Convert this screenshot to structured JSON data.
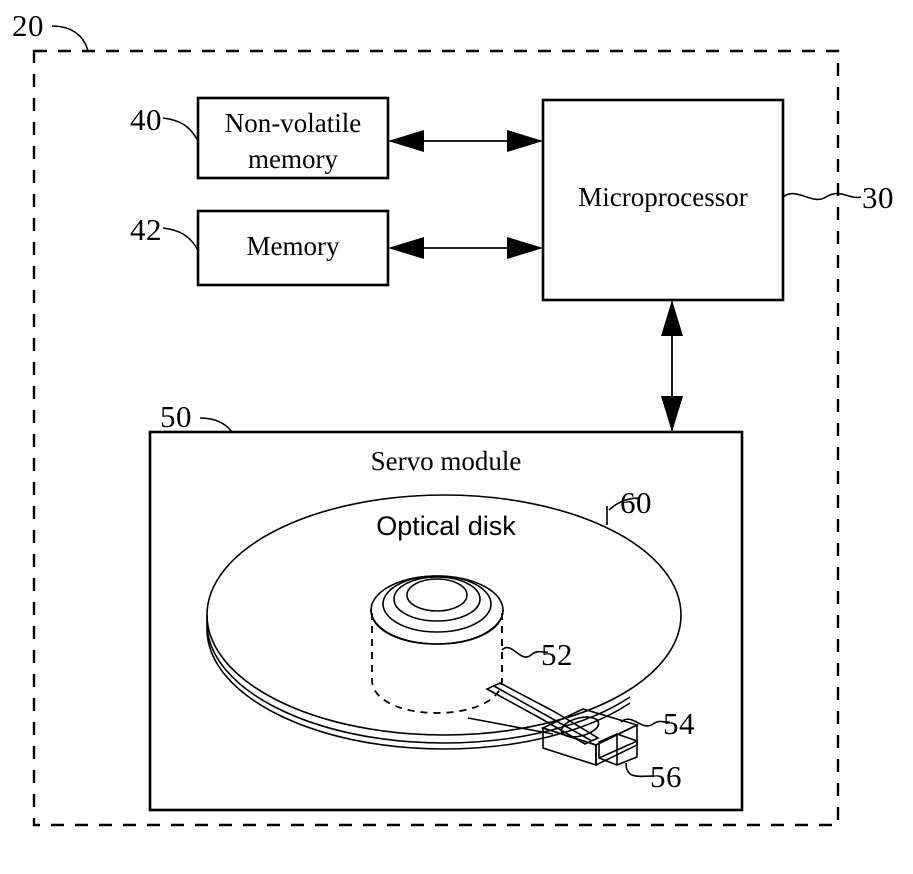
{
  "figure": {
    "title": "Optical disk drive block diagram",
    "line_color": "#000000",
    "background_color": "#ffffff"
  },
  "enclosure": {
    "ref": "20",
    "name": "optical-disk-drive-enclosure"
  },
  "blocks": [
    {
      "id": "nonvolatile-memory",
      "label_line1": "Non-volatile",
      "label_line2": "memory",
      "ref": "40"
    },
    {
      "id": "memory",
      "label_line1": "Memory",
      "label_line2": "",
      "ref": "42"
    },
    {
      "id": "microprocessor",
      "label_line1": "Microprocessor",
      "label_line2": "",
      "ref": "30"
    },
    {
      "id": "servo-module",
      "label_line1": "Servo module",
      "label_line2": "",
      "ref": "50"
    }
  ],
  "servo": {
    "module_label": "Servo module",
    "module_ref": "50",
    "disk_label": "Optical disk",
    "disk_ref": "60",
    "spindle_motor_ref": "52",
    "pickup_head_ref": "54",
    "connector_ref": "56"
  },
  "connectors": [
    {
      "id": "nvm-to-microprocessor",
      "type": "bidirectional-arrow",
      "orientation": "horizontal"
    },
    {
      "id": "memory-to-microprocessor",
      "type": "bidirectional-arrow",
      "orientation": "horizontal"
    },
    {
      "id": "microprocessor-to-servo",
      "type": "bidirectional-arrow",
      "orientation": "vertical"
    }
  ],
  "refs": {
    "r20": "20",
    "r30": "30",
    "r40": "40",
    "r42": "42",
    "r50": "50",
    "r52": "52",
    "r54": "54",
    "r56": "56",
    "r60": "60"
  },
  "labels": {
    "nonvolatile_line1": "Non-volatile",
    "nonvolatile_line2": "memory",
    "memory": "Memory",
    "microprocessor": "Microprocessor",
    "servo_module": "Servo module",
    "optical_disk": "Optical disk"
  }
}
